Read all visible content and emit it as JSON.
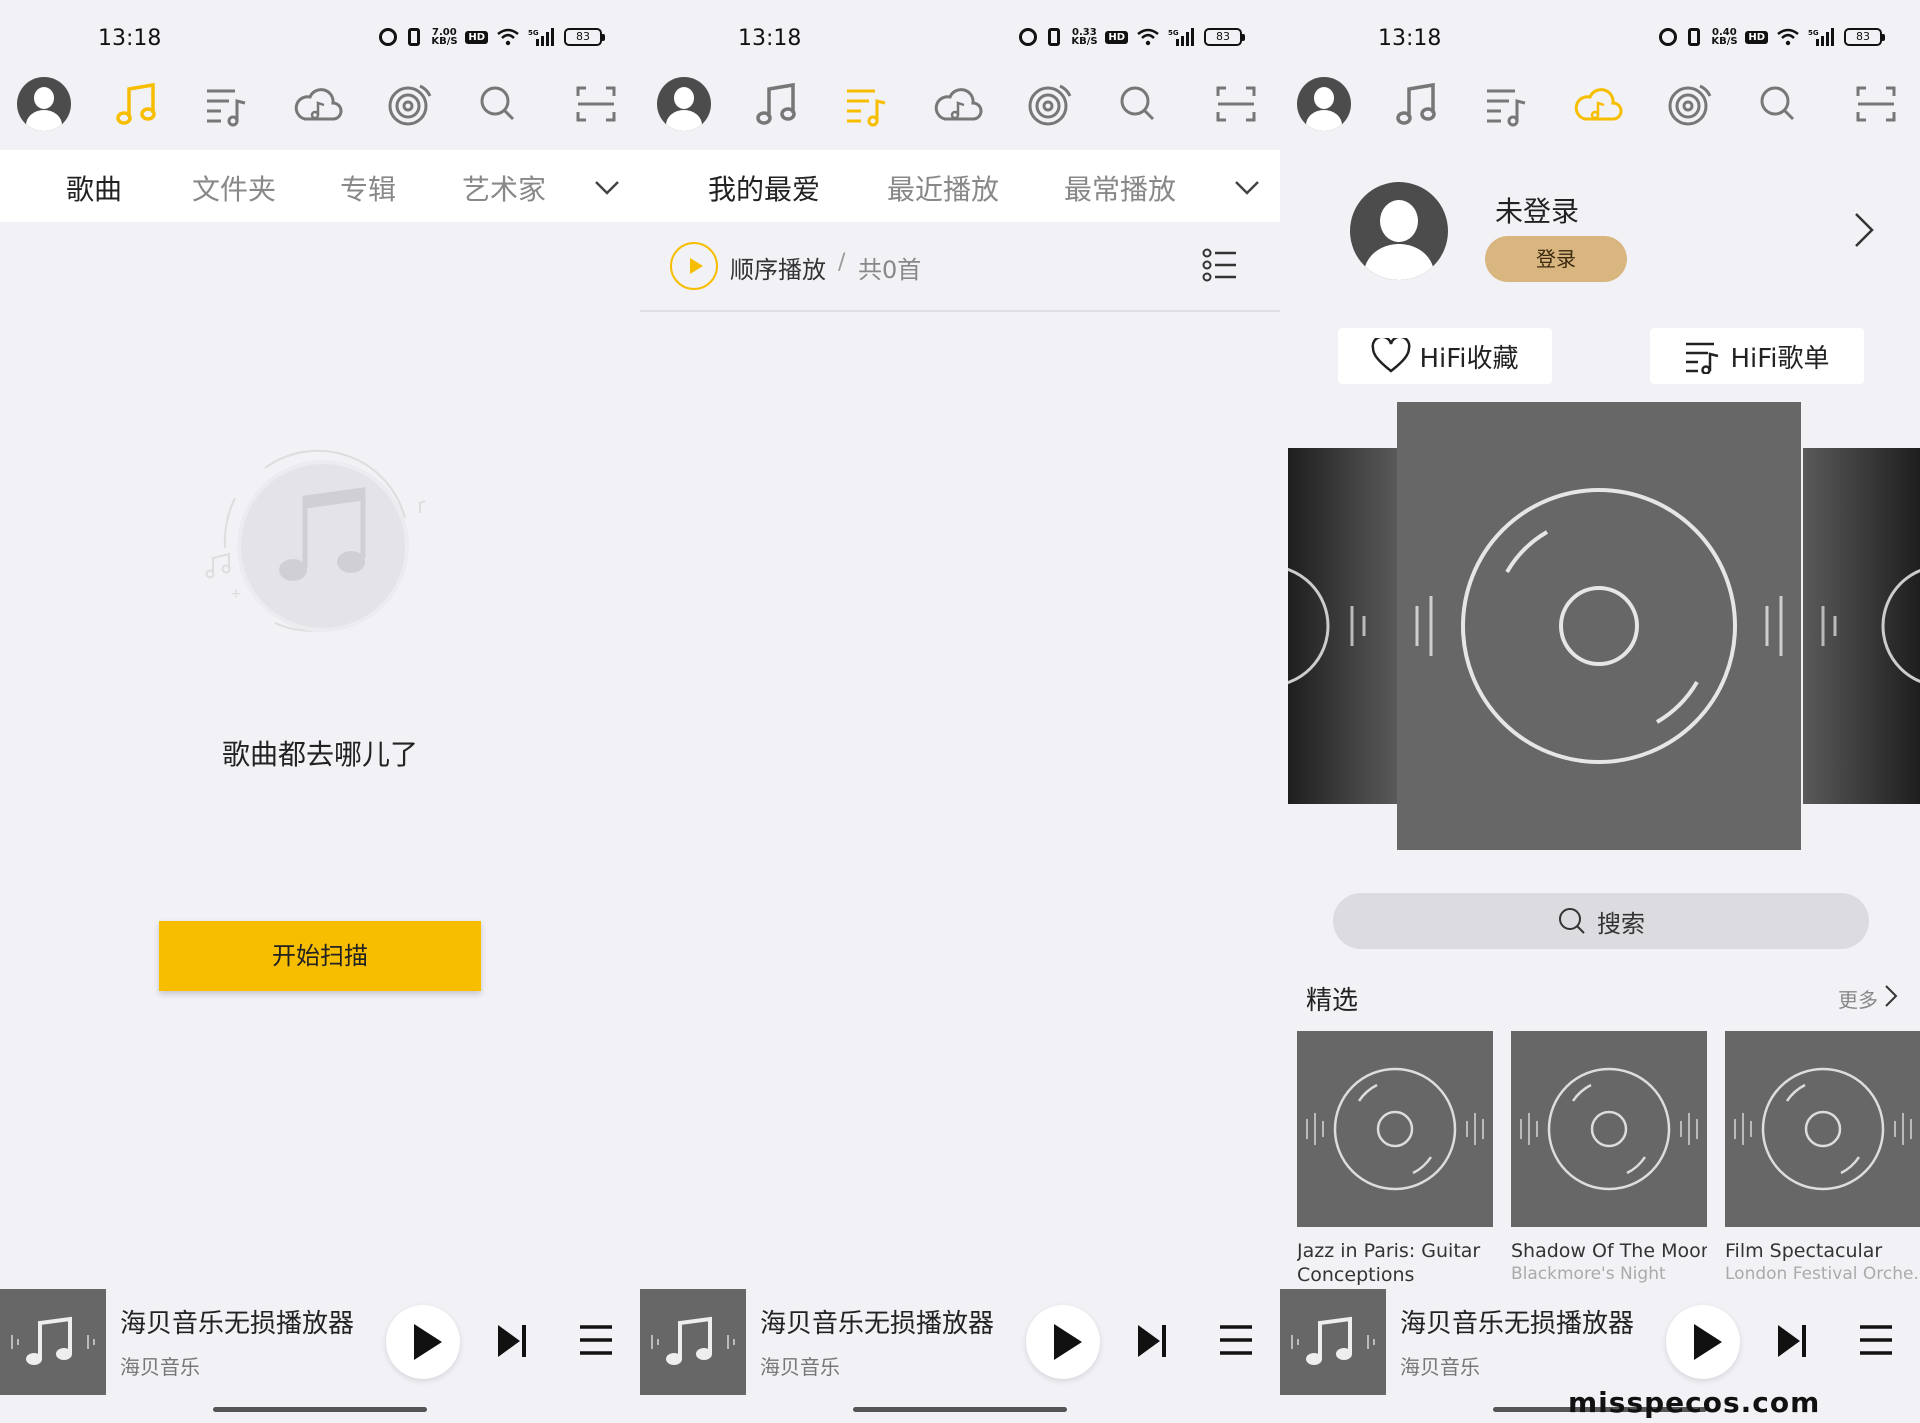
{
  "status_bar": {
    "time": "13:18",
    "battery": "83",
    "speeds": [
      "7.00 KB/S",
      "0.33 KB/S",
      "0.40 KB/S"
    ],
    "hd_label": "HD",
    "network_label": "5G"
  },
  "accent_color": "#f7be00",
  "nav_icons": [
    "avatar-icon",
    "music-note-icon",
    "playlist-icon",
    "cloud-music-icon",
    "radio-icon",
    "search-icon",
    "scan-icon"
  ],
  "screen1": {
    "tabs": [
      "歌曲",
      "文件夹",
      "专辑",
      "艺术家"
    ],
    "empty_text": "歌曲都去哪儿了",
    "scan_button": "开始扫描"
  },
  "screen2": {
    "tabs": [
      "我的最爱",
      "最近播放",
      "最常播放"
    ],
    "play_mode": "顺序播放",
    "separator": "/",
    "count": "共0首"
  },
  "screen3": {
    "profile_name": "未登录",
    "login_button": "登录",
    "hifi_fav": "HiFi收藏",
    "hifi_playlist": "HiFi歌单",
    "search_label": "搜索",
    "section_title": "精选",
    "section_more": "更多",
    "albums": [
      {
        "title": "Jazz in Paris: Guitar",
        "title2": "Conceptions",
        "artist": ""
      },
      {
        "title": "Shadow Of The Moon",
        "title2": "",
        "artist": "Blackmore's Night"
      },
      {
        "title": "Film Spectacular",
        "title2": "",
        "artist": "London Festival Orche..."
      }
    ]
  },
  "mini_player": {
    "title": "海贝音乐无损播放器",
    "subtitle": "海贝音乐"
  },
  "watermark": "misspecos.com"
}
